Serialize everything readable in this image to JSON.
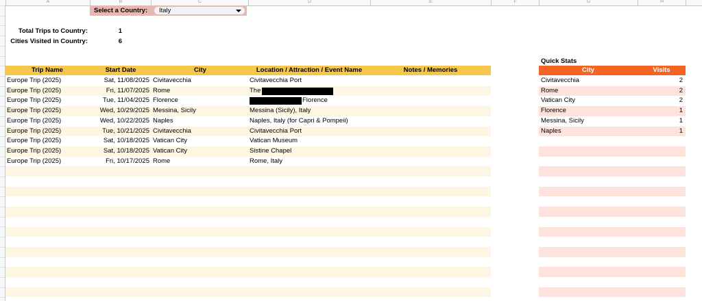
{
  "selector": {
    "label": "Select a Country:",
    "value": "Italy"
  },
  "summary": {
    "total_trips_label": "Total Trips to Country:",
    "total_trips_value": "1",
    "cities_visited_label": "Cities Visited in Country:",
    "cities_visited_value": "6"
  },
  "trips_table": {
    "headers": {
      "trip_name": "Trip Name",
      "start_date": "Start Date",
      "city": "City",
      "location": "Location / Attraction / Event Name",
      "notes": "Notes / Memories"
    },
    "rows": [
      {
        "trip": "Europe Trip (2025)",
        "date": "Sat, 11/08/2025",
        "city": "Civitavecchia",
        "location": "Civitavecchia Port"
      },
      {
        "trip": "Europe Trip (2025)",
        "date": "Fri, 11/07/2025",
        "city": "Rome",
        "location": "The"
      },
      {
        "trip": "Europe Trip (2025)",
        "date": "Tue, 11/04/2025",
        "city": "Florence",
        "location": "Florence"
      },
      {
        "trip": "Europe Trip (2025)",
        "date": "Wed, 10/29/2025",
        "city": "Messina, Sicily",
        "location": "Messina (Sicily), Italy"
      },
      {
        "trip": "Europe Trip (2025)",
        "date": "Wed, 10/22/2025",
        "city": "Naples",
        "location": "Naples, Italy (for Capri & Pompeii)"
      },
      {
        "trip": "Europe Trip (2025)",
        "date": "Tue, 10/21/2025",
        "city": "Civitavecchia",
        "location": "Civitavecchia Port"
      },
      {
        "trip": "Europe Trip (2025)",
        "date": "Sat, 10/18/2025",
        "city": "Vatican City",
        "location": "Vatican Museum"
      },
      {
        "trip": "Europe Trip (2025)",
        "date": "Sat, 10/18/2025",
        "city": "Vatican City",
        "location": "Sistine Chapel"
      },
      {
        "trip": "Europe Trip (2025)",
        "date": "Fri, 10/17/2025",
        "city": "Rome",
        "location": "Rome, Italy"
      }
    ]
  },
  "quick_stats": {
    "title": "Quick Stats",
    "headers": {
      "city": "City",
      "visits": "Visits"
    },
    "rows": [
      {
        "city": "Civitavecchia",
        "visits": "2"
      },
      {
        "city": "Rome",
        "visits": "2"
      },
      {
        "city": "Vatican City",
        "visits": "2"
      },
      {
        "city": "Florence",
        "visits": "1"
      },
      {
        "city": "Messina, Sicily",
        "visits": "1"
      },
      {
        "city": "Naples",
        "visits": "1"
      }
    ]
  },
  "colors": {
    "table_header": "#f6c64a",
    "table_band": "#fdf6e3",
    "stats_header": "#f46524",
    "stats_band": "#fde3dc",
    "selector_bg": "#e6b8af"
  }
}
